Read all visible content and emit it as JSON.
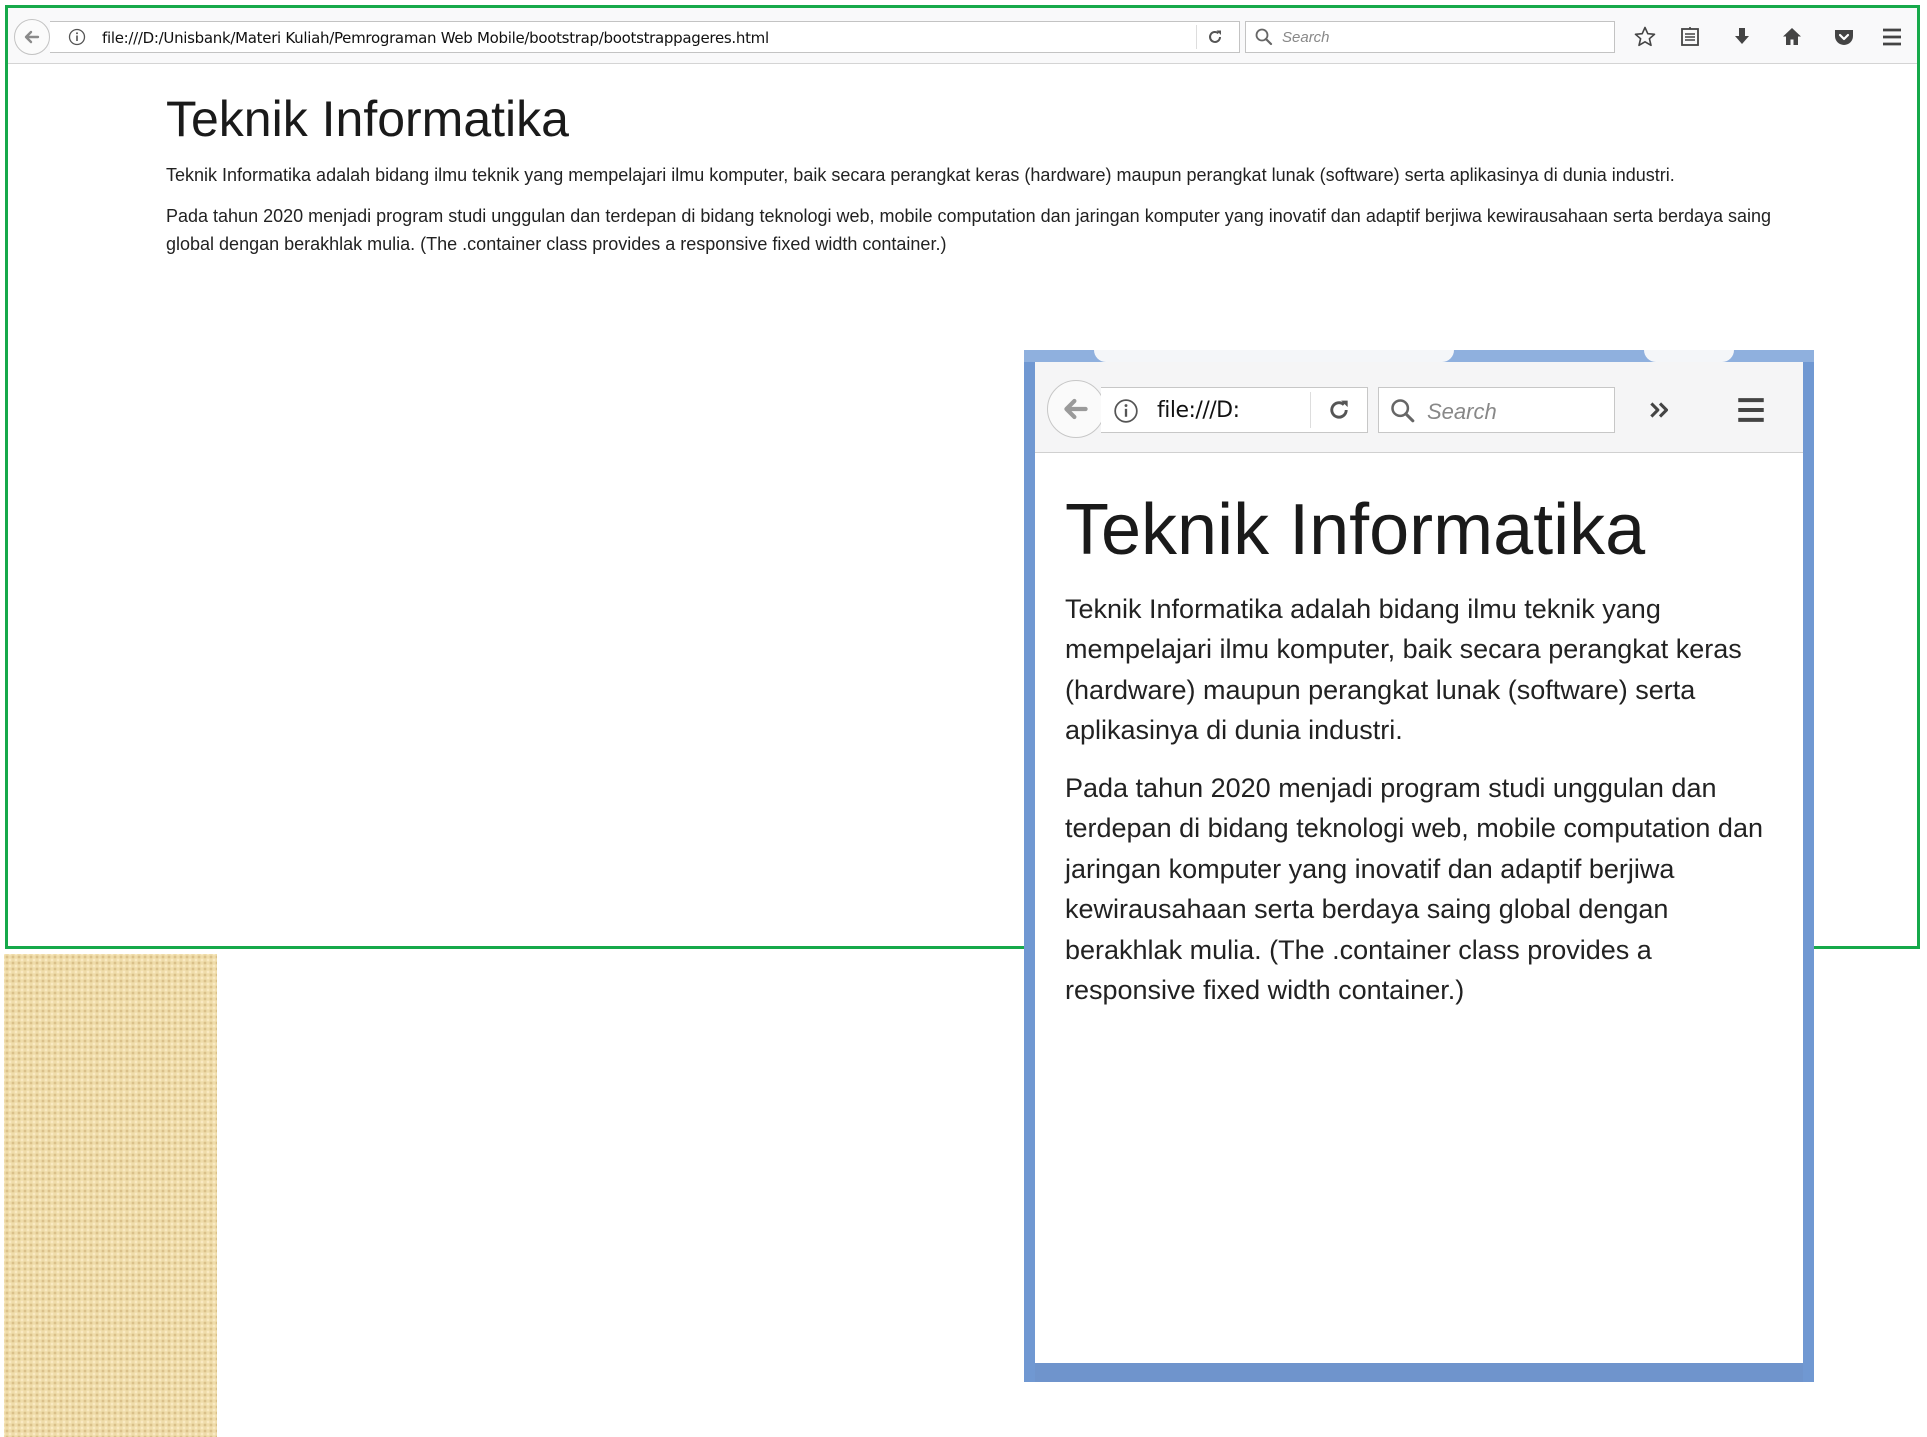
{
  "main_window": {
    "url": "file:///D:/Unisbank/Materi Kuliah/Pemrograman Web Mobile/bootstrap/bootstrappageres.html",
    "search_placeholder": "Search",
    "page": {
      "heading": "Teknik Informatika",
      "paragraphs": [
        "Teknik Informatika adalah bidang ilmu teknik yang mempelajari ilmu komputer, baik secara perangkat keras (hardware) maupun perangkat lunak (software) serta aplikasinya di dunia industri.",
        "Pada tahun 2020 menjadi program studi unggulan dan terdepan di bidang teknologi web, mobile computation dan jaringan komputer yang inovatif dan adaptif berjiwa kewirausahaan serta berdaya saing global dengan berakhlak mulia. (The .container class provides a responsive fixed width container.)"
      ]
    },
    "icons": [
      "back-arrow-icon",
      "info-icon",
      "reload-icon",
      "search-icon",
      "star-icon",
      "reading-list-icon",
      "download-icon",
      "home-icon",
      "pocket-icon",
      "menu-icon"
    ]
  },
  "small_window": {
    "url": "file:///D:",
    "search_placeholder": "Search",
    "page": {
      "heading": "Teknik Informatika",
      "paragraphs": [
        "Teknik Informatika adalah bidang ilmu teknik yang mempelajari ilmu komputer, baik secara perangkat keras (hardware) maupun perangkat lunak (software) serta aplikasinya di dunia industri.",
        "Pada tahun 2020 menjadi program studi unggulan dan terdepan di bidang teknologi web, mobile computation dan jaringan komputer yang inovatif dan adaptif berjiwa kewirausahaan serta berdaya saing global dengan berakhlak mulia. (The .container class provides a responsive fixed width container.)"
      ]
    },
    "icons": [
      "back-arrow-icon",
      "info-icon",
      "reload-icon",
      "search-icon",
      "overflow-chevron-icon",
      "menu-icon"
    ]
  },
  "colors": {
    "main_window_border": "#16a94a",
    "small_window_frame": "#7098d2",
    "toolbar_bg": "#f9f9fa",
    "pattern_bg": "#efdcaa"
  }
}
